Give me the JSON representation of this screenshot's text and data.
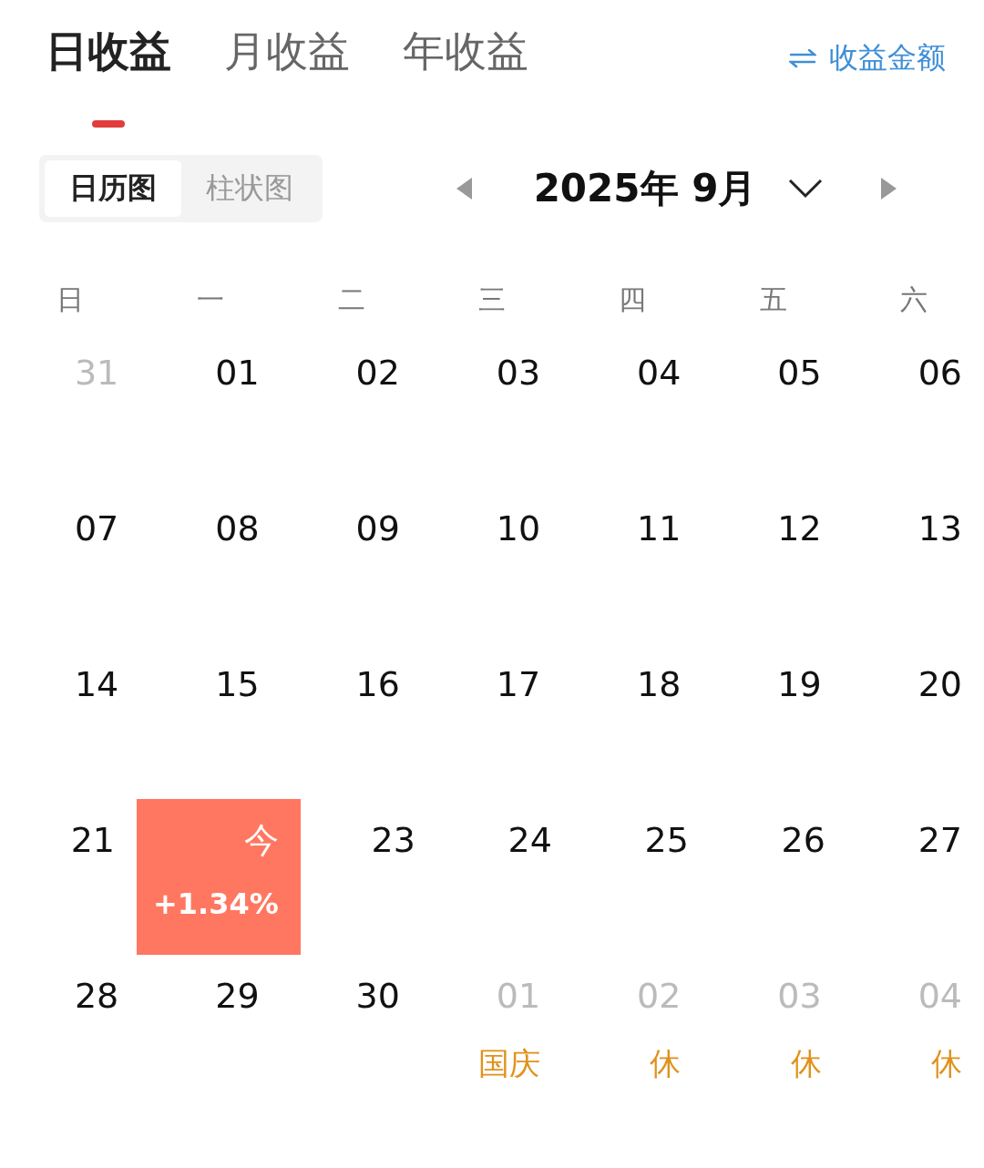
{
  "tabs": [
    {
      "label": "日收益",
      "selected": true
    },
    {
      "label": "月收益",
      "selected": false
    },
    {
      "label": "年收益",
      "selected": false
    }
  ],
  "switch_link": {
    "label": "收益金额"
  },
  "view_toggle": [
    {
      "label": "日历图",
      "selected": true
    },
    {
      "label": "柱状图",
      "selected": false
    }
  ],
  "month": {
    "title": "2025年 9月"
  },
  "weekdays": [
    "日",
    "一",
    "二",
    "三",
    "四",
    "五",
    "六"
  ],
  "weeks": [
    [
      {
        "kind": "other",
        "day": "31"
      },
      {
        "kind": "day",
        "day": "01"
      },
      {
        "kind": "day",
        "day": "02"
      },
      {
        "kind": "day",
        "day": "03"
      },
      {
        "kind": "day",
        "day": "04"
      },
      {
        "kind": "day",
        "day": "05"
      },
      {
        "kind": "day",
        "day": "06"
      }
    ],
    [
      {
        "kind": "day",
        "day": "07"
      },
      {
        "kind": "day",
        "day": "08"
      },
      {
        "kind": "day",
        "day": "09"
      },
      {
        "kind": "day",
        "day": "10"
      },
      {
        "kind": "day",
        "day": "11"
      },
      {
        "kind": "day",
        "day": "12"
      },
      {
        "kind": "day",
        "day": "13"
      }
    ],
    [
      {
        "kind": "day",
        "day": "14"
      },
      {
        "kind": "day",
        "day": "15"
      },
      {
        "kind": "day",
        "day": "16"
      },
      {
        "kind": "day",
        "day": "17"
      },
      {
        "kind": "day",
        "day": "18"
      },
      {
        "kind": "day",
        "day": "19"
      },
      {
        "kind": "day",
        "day": "20"
      }
    ],
    [
      {
        "kind": "day",
        "day": "21"
      },
      {
        "kind": "today",
        "day": "今",
        "change": "+1.34%"
      },
      {
        "kind": "day",
        "day": "23"
      },
      {
        "kind": "day",
        "day": "24"
      },
      {
        "kind": "day",
        "day": "25"
      },
      {
        "kind": "day",
        "day": "26"
      },
      {
        "kind": "day",
        "day": "27"
      }
    ],
    [
      {
        "kind": "day",
        "day": "28"
      },
      {
        "kind": "day",
        "day": "29"
      },
      {
        "kind": "day",
        "day": "30"
      },
      {
        "kind": "other",
        "day": "01",
        "note": "国庆"
      },
      {
        "kind": "other",
        "day": "02",
        "note": "休"
      },
      {
        "kind": "other",
        "day": "03",
        "note": "休"
      },
      {
        "kind": "other",
        "day": "04",
        "note": "休"
      }
    ]
  ]
}
